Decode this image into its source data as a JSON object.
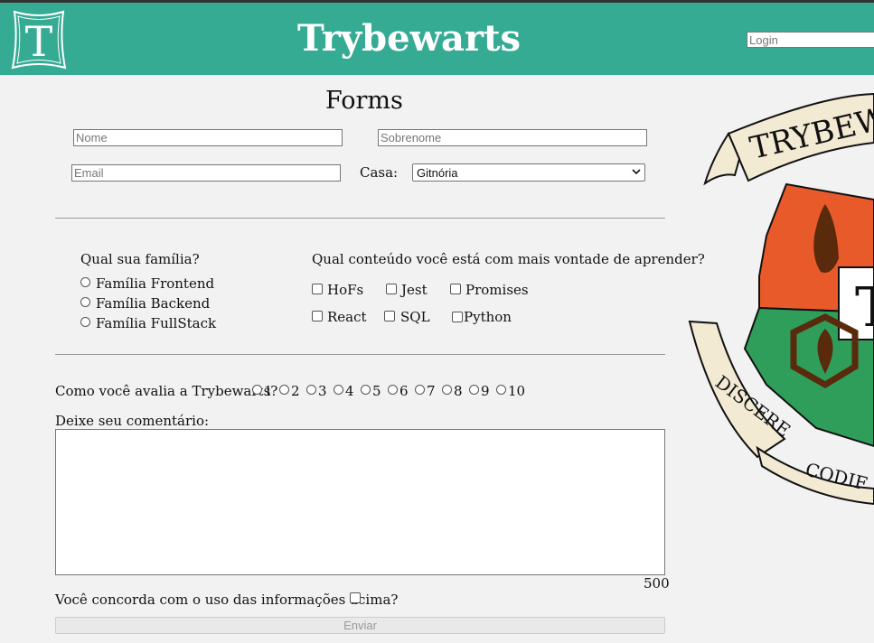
{
  "header": {
    "logo_letter": "T",
    "brand": "Trybewarts",
    "login_placeholder": "Login"
  },
  "form": {
    "title": "Forms",
    "name_placeholder": "Nome",
    "surname_placeholder": "Sobrenome",
    "email_placeholder": "Email",
    "house_label": "Casa:",
    "house_selected": "Gitnória",
    "family_question": "Qual sua família?",
    "families": [
      "Família Frontend",
      "Família Backend",
      "Família FullStack"
    ],
    "content_question": "Qual conteúdo você está com mais vontade de aprender?",
    "contents": [
      "HoFs",
      "Jest",
      "Promises",
      "React",
      "SQL",
      "Python"
    ],
    "rating_question": "Como você avalia a Trybewarts?",
    "ratings": [
      "1",
      "2",
      "3",
      "4",
      "5",
      "6",
      "7",
      "8",
      "9",
      "10"
    ],
    "comment_label": "Deixe seu comentário:",
    "char_counter": "500",
    "agreement_label": "Você concorda com o uso das informações acima?",
    "submit_label": "Enviar"
  },
  "crest": {
    "banner_top": "TRYBEW",
    "motto_left": "DISCERE",
    "motto_bottom": "CODIF",
    "shield_letter": "T"
  },
  "colors": {
    "header_bg": "#36ab94",
    "crest_orange": "#e85a2a",
    "crest_green": "#2f9e5a",
    "crest_brown": "#5a2a0c",
    "banner_cream": "#f3ead3"
  }
}
